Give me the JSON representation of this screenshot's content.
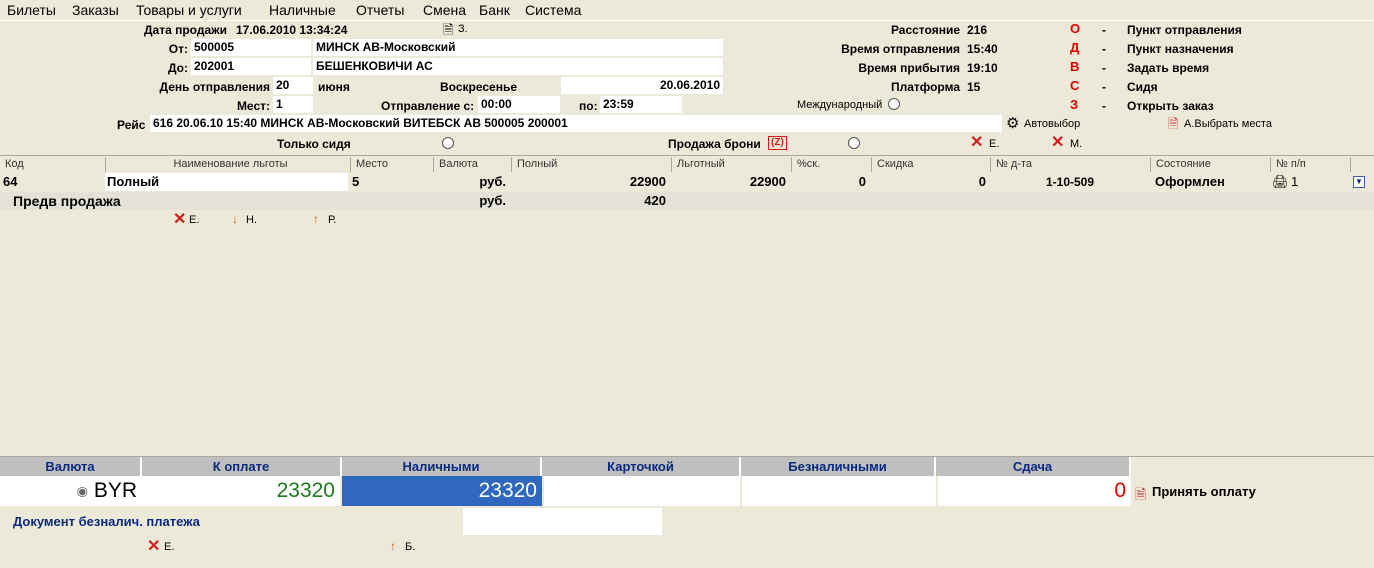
{
  "menu": [
    "Билеты",
    "Заказы",
    "Товары и услуги",
    "Наличные",
    "Отчеты",
    "Смена",
    "Банк",
    "Система"
  ],
  "header": {
    "sale_date_label": "Дата продажи",
    "sale_date": "17.06.2010 13:34:24",
    "z_label": "З.",
    "from_label": "От:",
    "from_code": "500005",
    "from_name": "МИНСК АВ-Московский",
    "to_label": "До:",
    "to_code": "202001",
    "to_name": "БЕШЕНКОВИЧИ АС",
    "dep_day_label": "День отправления",
    "dep_day": "20",
    "dep_month": "июня",
    "weekday": "Воскресенье",
    "dep_date": "20.06.2010",
    "seats_label": "Мест:",
    "seats": "1",
    "depart_from_label": "Отправление с:",
    "depart_from": "00:00",
    "depart_to_label": "по:",
    "depart_to": "23:59",
    "international_label": "Международный",
    "trip_label": "Рейс",
    "trip_value": "616 20.06.10 15:40 МИНСК АВ-Московский ВИТЕБСК АВ 500005 200001",
    "auto_select_label": "Автовыбор",
    "choose_seats_label": "А.Выбрать места",
    "only_seated_label": "Только сидя",
    "booking_sale_label": "Продажа брони",
    "booking_sale_hotkey": "(Z)",
    "x_e_label": "Е.",
    "x_m_label": "М."
  },
  "info": [
    {
      "label": "Расстояние",
      "value": "216"
    },
    {
      "label": "Время отправления",
      "value": "15:40"
    },
    {
      "label": "Время прибытия",
      "value": "19:10"
    },
    {
      "label": "Платформа",
      "value": "15"
    }
  ],
  "hotkeys": [
    {
      "key": "О",
      "dash": "-",
      "label": "Пункт отправления"
    },
    {
      "key": "Д",
      "dash": "-",
      "label": "Пункт назначения"
    },
    {
      "key": "В",
      "dash": "-",
      "label": "Задать время"
    },
    {
      "key": "С",
      "dash": "-",
      "label": "Сидя"
    },
    {
      "key": "З",
      "dash": "-",
      "label": "Открыть заказ"
    }
  ],
  "grid": {
    "columns": [
      "Код",
      "Наименование льготы",
      "Место",
      "Валюта",
      "Полный",
      "Льготный",
      "%ск.",
      "Скидка",
      "№ д-та",
      "Состояние",
      "№ п/п"
    ],
    "row": {
      "code": "64",
      "benefit": "Полный",
      "seat": "5",
      "currency": "руб.",
      "full": "22900",
      "discounted": "22900",
      "pct": "0",
      "discount": "0",
      "doc_no": "1-10-509",
      "status": "Оформлен",
      "num": "1"
    },
    "presale": {
      "label": "Предв продажа",
      "currency": "руб.",
      "value": "420"
    },
    "actions": {
      "e": "Е.",
      "n": "Н.",
      "r": "Р."
    }
  },
  "payment": {
    "headers": [
      "Валюта",
      "К оплате",
      "Наличными",
      "Карточкой",
      "Безналичными",
      "Сдача"
    ],
    "currency": "BYR",
    "to_pay": "23320",
    "cash": "23320",
    "card": "",
    "cashless": "",
    "change": "0",
    "accept_label": "Принять оплату",
    "doc_label": "Документ безналич. платежа",
    "doc_value": "",
    "e_label": "Е.",
    "b_label": "Б.",
    "colors": {
      "to_pay": "#1e7a1e",
      "change": "#e00000",
      "cash_bg": "#3068c0",
      "header_text": "#0b2a7e"
    }
  }
}
